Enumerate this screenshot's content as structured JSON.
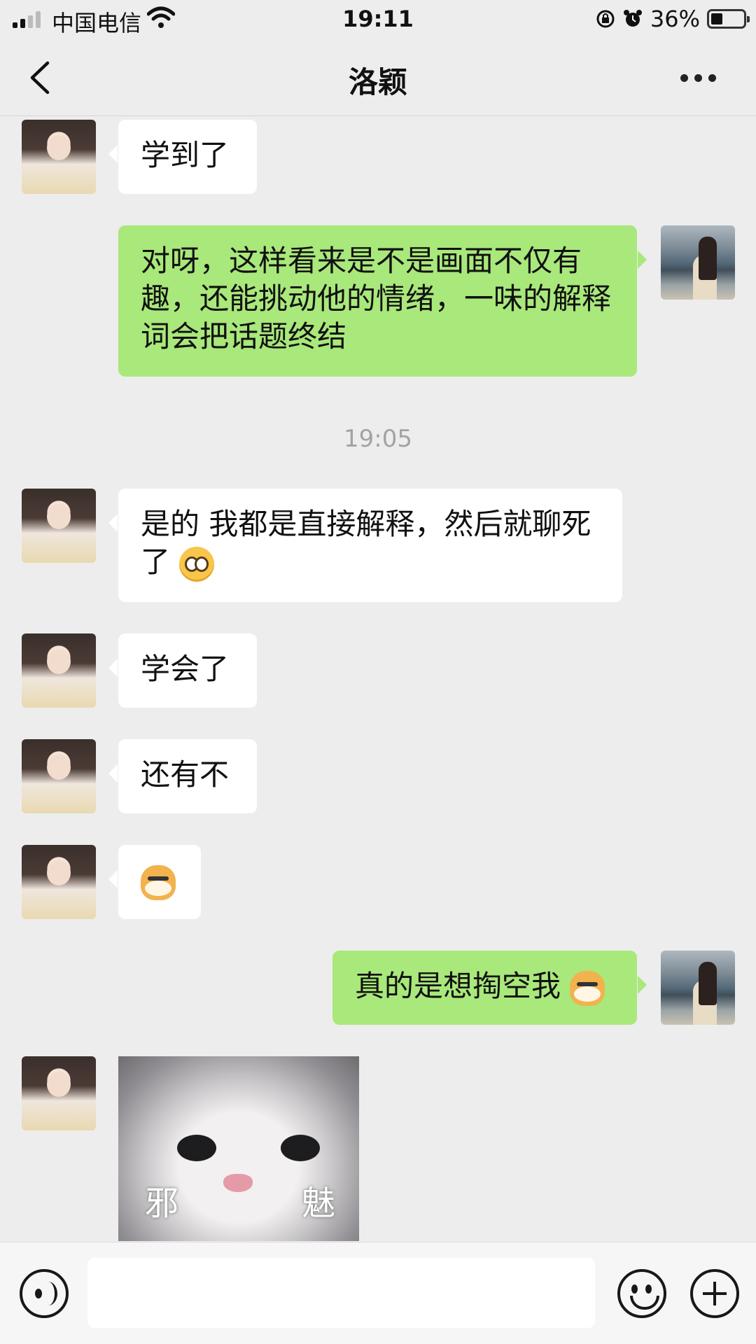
{
  "status_bar": {
    "carrier": "中国电信",
    "time": "19:11",
    "battery_percent_text": "36%",
    "battery_level": 0.36,
    "signal_bars_active": 2,
    "icons": [
      "signal-icon",
      "wifi-icon",
      "rotation-lock-icon",
      "alarm-icon",
      "battery-icon"
    ]
  },
  "header": {
    "title": "洛颖",
    "back_icon": "chevron-left-icon",
    "more_icon": "more-dots-icon"
  },
  "messages": [
    {
      "sender": "them",
      "text": "学到了"
    },
    {
      "sender": "me",
      "text": "对呀，这样看来是不是画面不仅有趣，还能挑动他的情绪，一味的解释词会把话题终结"
    },
    {
      "type": "time",
      "text": "19:05"
    },
    {
      "sender": "them",
      "text": "是的  我都是直接解释，然后就聊死了",
      "emoji": "pleading-face-emoji"
    },
    {
      "sender": "them",
      "text": "学会了"
    },
    {
      "sender": "them",
      "text": "还有不"
    },
    {
      "sender": "them",
      "text": "",
      "emoji": "doge-emoji"
    },
    {
      "sender": "me",
      "text": "真的是想掏空我",
      "emoji": "doge-emoji"
    },
    {
      "sender": "them",
      "type": "sticker",
      "sticker": {
        "caption_left": "邪",
        "caption_right": "魅"
      }
    }
  ],
  "input_bar": {
    "voice_icon": "voice-icon",
    "emoji_icon": "emoji-smile-icon",
    "plus_icon": "plus-icon",
    "value": ""
  }
}
